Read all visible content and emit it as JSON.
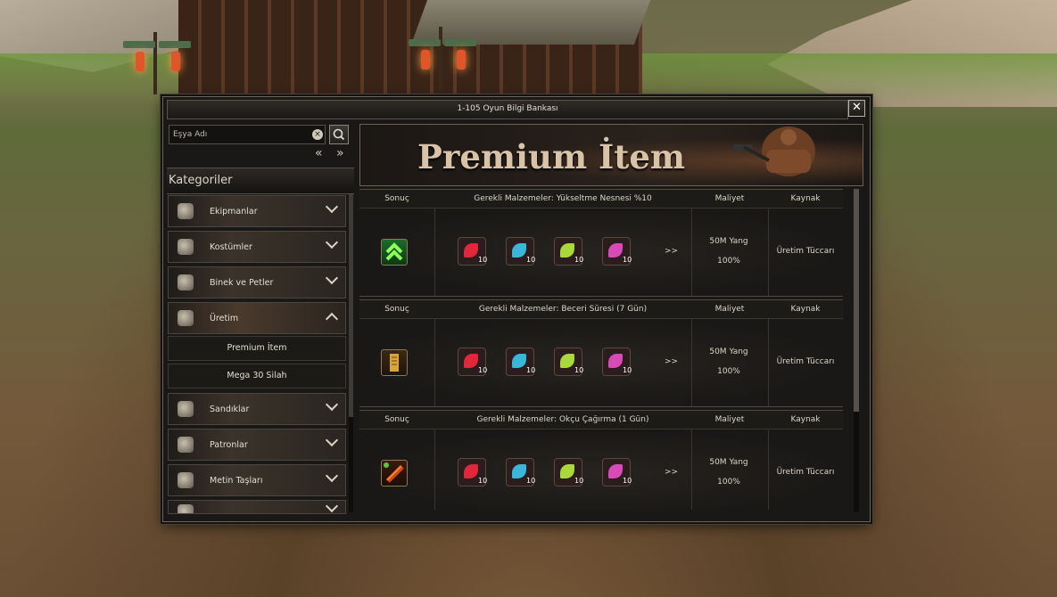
{
  "window": {
    "title": "1-105 Oyun Bilgi Bankası",
    "close_label": "✕"
  },
  "search": {
    "placeholder": "Eşya Adı",
    "clear_icon": "clear-icon",
    "search_icon": "magnifier-icon"
  },
  "nav": {
    "prev": "«",
    "next": "»"
  },
  "categories_title": "Kategoriler",
  "categories": [
    {
      "label": "Ekipmanlar",
      "icon": "sword-icon",
      "expanded": false
    },
    {
      "label": "Kostümler",
      "icon": "armor-icon",
      "expanded": false
    },
    {
      "label": "Binek ve Petler",
      "icon": "mount-icon",
      "expanded": false
    },
    {
      "label": "Üretim",
      "icon": "pouch-icon",
      "expanded": true
    },
    {
      "label": "Sandıklar",
      "icon": "chest-icon",
      "expanded": false
    },
    {
      "label": "Patronlar",
      "icon": "boss-icon",
      "expanded": false
    },
    {
      "label": "Metin Taşları",
      "icon": "stone-icon",
      "expanded": false
    }
  ],
  "subcategories": [
    {
      "label": "Premium İtem"
    },
    {
      "label": "Mega 30 Silah"
    }
  ],
  "banner": {
    "title": "Premium İtem"
  },
  "colors": {
    "accent": "#d9c3a8",
    "border": "#6c6457",
    "panel": "#1a1816"
  },
  "recipes": [
    {
      "col_result": "Sonuç",
      "col_materials": "Gerekli Malzemeler: Yükseltme Nesnesi %10",
      "col_cost": "Maliyet",
      "col_source": "Kaynak",
      "result_icon": "upgrade-arrow-icon",
      "materials": [
        {
          "count": "10",
          "color": "#e0283a"
        },
        {
          "count": "10",
          "color": "#3ab6d8"
        },
        {
          "count": "10",
          "color": "#a8d83a"
        },
        {
          "count": "10",
          "color": "#d84ab8"
        }
      ],
      "arrow": ">>",
      "cost_amount": "50M Yang",
      "cost_rate": "100%",
      "source": "Üretim Tüccarı"
    },
    {
      "col_result": "Sonuç",
      "col_materials": "Gerekli Malzemeler: Beceri Süresi (7 Gün)",
      "col_cost": "Maliyet",
      "col_source": "Kaynak",
      "result_icon": "skill-scroll-icon",
      "materials": [
        {
          "count": "10",
          "color": "#e0283a"
        },
        {
          "count": "10",
          "color": "#3ab6d8"
        },
        {
          "count": "10",
          "color": "#a8d83a"
        },
        {
          "count": "10",
          "color": "#d84ab8"
        }
      ],
      "arrow": ">>",
      "cost_amount": "50M Yang",
      "cost_rate": "100%",
      "source": "Üretim Tüccarı"
    },
    {
      "col_result": "Sonuç",
      "col_materials": "Gerekli Malzemeler: Okçu Çağırma (1 Gün)",
      "col_cost": "Maliyet",
      "col_source": "Kaynak",
      "result_icon": "fire-arrow-icon",
      "materials": [
        {
          "count": "10",
          "color": "#e0283a"
        },
        {
          "count": "10",
          "color": "#3ab6d8"
        },
        {
          "count": "10",
          "color": "#a8d83a"
        },
        {
          "count": "10",
          "color": "#d84ab8"
        }
      ],
      "arrow": ">>",
      "cost_amount": "50M Yang",
      "cost_rate": "100%",
      "source": "Üretim Tüccarı"
    }
  ]
}
